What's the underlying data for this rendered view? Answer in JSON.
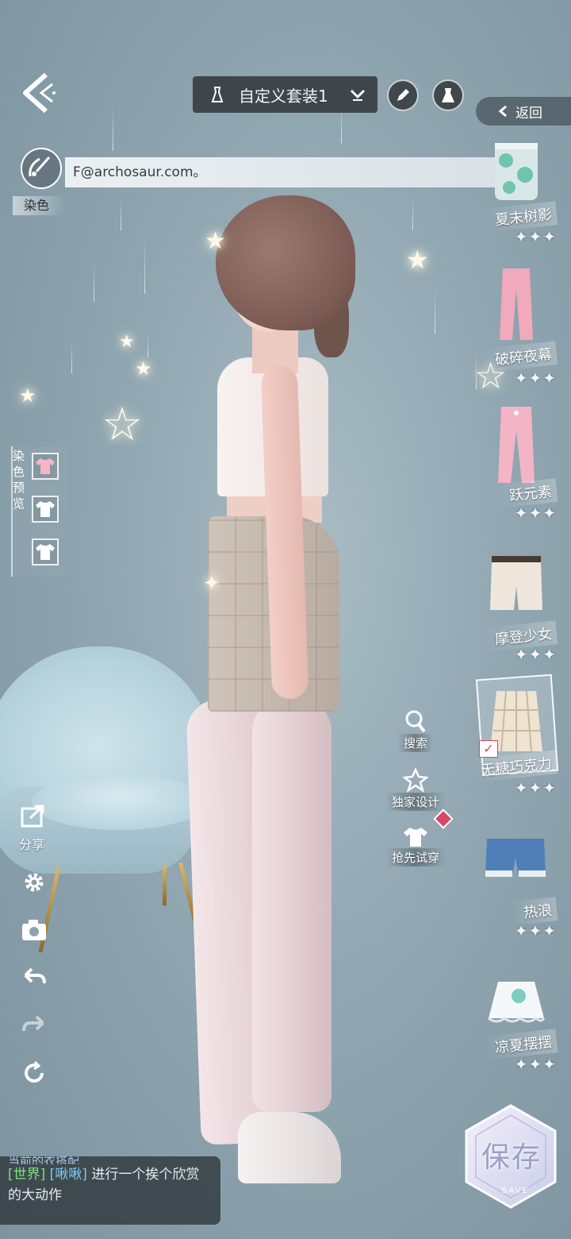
{
  "header": {
    "outfit_name": "自定义套装1",
    "return_label": "返回"
  },
  "banner": {
    "text": "F@archosaur.com。"
  },
  "dye": {
    "label": "染色"
  },
  "dye_preview": {
    "label": "染色预览",
    "label_chars": [
      "染",
      "色",
      "预",
      "览"
    ],
    "swatch_colors": [
      "#f5b6c6",
      "#ffffff",
      "#ffffff"
    ]
  },
  "wardrobe": {
    "items": [
      {
        "name": "夏末树影",
        "stars": "✦✦✦"
      },
      {
        "name": "破碎夜幕",
        "stars": "✦✦✦"
      },
      {
        "name": "跃元素",
        "stars": "✦✦✦"
      },
      {
        "name": "摩登少女",
        "stars": "✦✦✦"
      },
      {
        "name": "无糖巧克力",
        "stars": "✦✦✦",
        "selected": true
      },
      {
        "name": "热浪",
        "stars": "✦✦✦"
      },
      {
        "name": "凉夏摆摆",
        "stars": "✦✦✦"
      }
    ]
  },
  "tools": {
    "search": "搜索",
    "exclusive": "独家设计",
    "try_first": "抢先试穿"
  },
  "left_tools": {
    "share": "分享"
  },
  "save": {
    "label": "保存",
    "sub": "SAVE"
  },
  "chat": {
    "line0": "当前的衣搭配",
    "channel": "[世界]",
    "user": "[啾啾]",
    "message": "进行一个挨个欣赏的大动作"
  },
  "colors": {
    "accent_pink": "#d34a6a",
    "chat_channel": "#7fe27a",
    "chat_user": "#7fc8f0"
  }
}
